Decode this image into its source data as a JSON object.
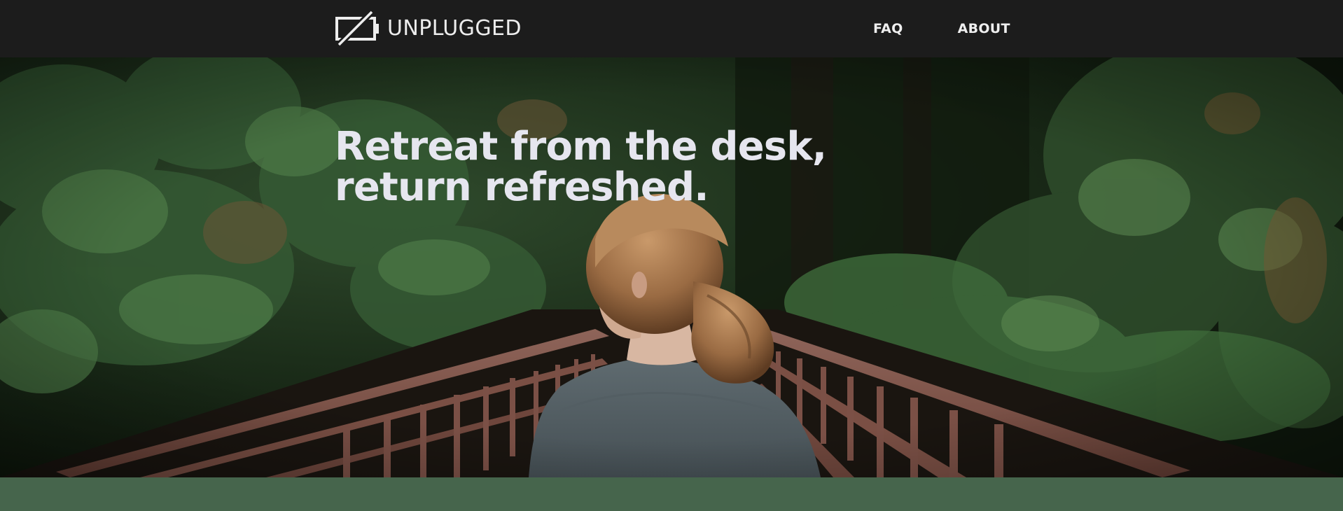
{
  "brand": {
    "name": "UNPLUGGED",
    "icon": "unplugged-battery-logo-icon"
  },
  "nav": {
    "items": [
      {
        "label": "FAQ"
      },
      {
        "label": "ABOUT"
      }
    ]
  },
  "hero": {
    "title_line_1": "Retreat from the desk,",
    "title_line_2": "return refreshed.",
    "image": "woman-on-forest-bridge-photo"
  },
  "colors": {
    "navbar_bg": "#1c1c1c",
    "nav_text": "#efefef",
    "hero_text": "#e6e6ef",
    "band_green": "#46654c"
  }
}
